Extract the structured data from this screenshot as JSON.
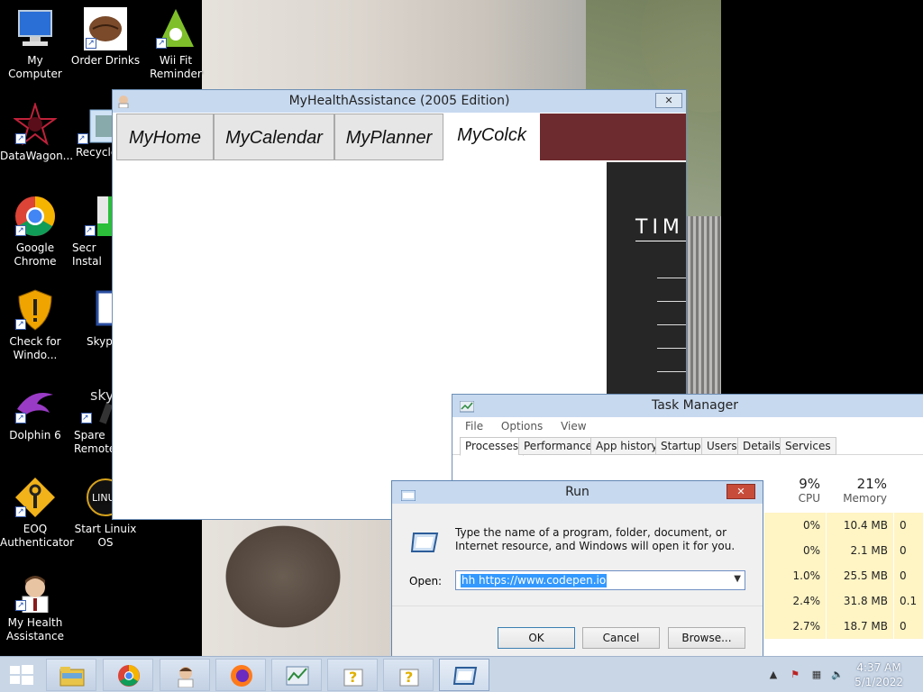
{
  "desktop": {
    "icons": [
      {
        "label": "My Computer"
      },
      {
        "label": "Order Drinks"
      },
      {
        "label": "Wii Fit Reminder"
      },
      {
        "label": "DataWagon..."
      },
      {
        "label": "Recycle"
      },
      {
        "label": "Google Chrome"
      },
      {
        "label": "Secr Instal"
      },
      {
        "label": "Check for Windo..."
      },
      {
        "label": "Skyp"
      },
      {
        "label": "Dolphin 6"
      },
      {
        "label": "Spare Remote"
      },
      {
        "label": "EOQ Authenticator"
      },
      {
        "label": "Start Linuix OS"
      },
      {
        "label": "My Health Assistance"
      }
    ]
  },
  "mha": {
    "title": "MyHealthAssistance (2005 Edition)",
    "tabs": [
      "MyHome",
      "MyCalendar",
      "MyPlanner",
      "MyColck"
    ],
    "active_tab": "MyColck",
    "clock_title": "TIME",
    "accent": "#6d2b2f"
  },
  "taskmgr": {
    "title": "Task Manager",
    "menu": [
      "File",
      "Options",
      "View"
    ],
    "tabs": [
      "Processes",
      "Performance",
      "App history",
      "Startup",
      "Users",
      "Details",
      "Services"
    ],
    "cpu_pct": "9%",
    "cpu_label": "CPU",
    "mem_pct": "21%",
    "mem_label": "Memory",
    "rows": [
      {
        "cpu": "0%",
        "mem": "10.4 MB",
        "disk": "0"
      },
      {
        "cpu": "0%",
        "mem": "2.1 MB",
        "disk": "0"
      },
      {
        "cpu": "1.0%",
        "mem": "25.5 MB",
        "disk": "0"
      },
      {
        "cpu": "2.4%",
        "mem": "31.8 MB",
        "disk": "0.1"
      },
      {
        "cpu": "2.7%",
        "mem": "18.7 MB",
        "disk": "0"
      }
    ]
  },
  "run": {
    "title": "Run",
    "description": "Type the name of a program, folder, document, or Internet resource, and Windows will open it for you.",
    "open_label": "Open:",
    "open_value": "hh https://www.codepen.io",
    "ok": "OK",
    "cancel": "Cancel",
    "browse": "Browse..."
  },
  "taskbar": {
    "time": "4:37 AM",
    "date": "5/1/2022"
  }
}
